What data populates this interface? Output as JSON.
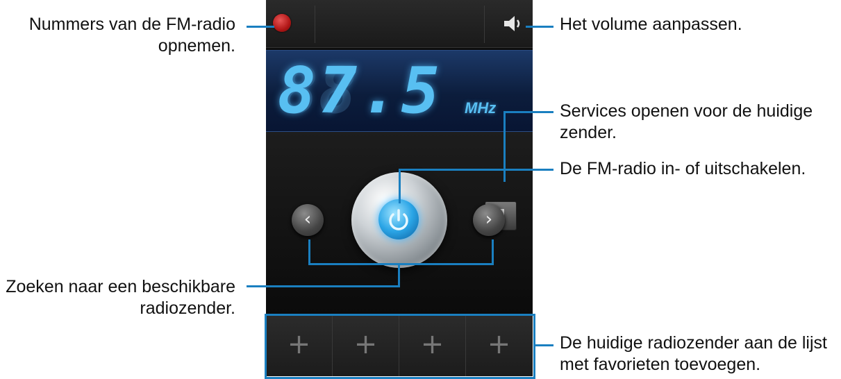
{
  "callouts": {
    "record": [
      "Nummers van de FM-radio",
      "opnemen."
    ],
    "volume": [
      "Het volume aanpassen."
    ],
    "services": [
      "Services openen voor de huidige",
      "zender."
    ],
    "power": [
      "De FM-radio in- of uitschakelen."
    ],
    "search": [
      "Zoeken naar een beschikbare",
      "radiozender."
    ],
    "favorites": [
      "De huidige radiozender aan de lijst",
      "met favorieten toevoegen."
    ]
  },
  "radio": {
    "frequency": "87.5",
    "ghost_digits": "88",
    "unit": "MHz",
    "favorites": [
      "+",
      "+",
      "+",
      "+"
    ],
    "prev_label": "‹",
    "next_label": "›"
  },
  "colors": {
    "leader": "#1a7fc0",
    "display_digits": "#58bff2",
    "record": "#c01e1e",
    "power": "#2ba5e6"
  }
}
